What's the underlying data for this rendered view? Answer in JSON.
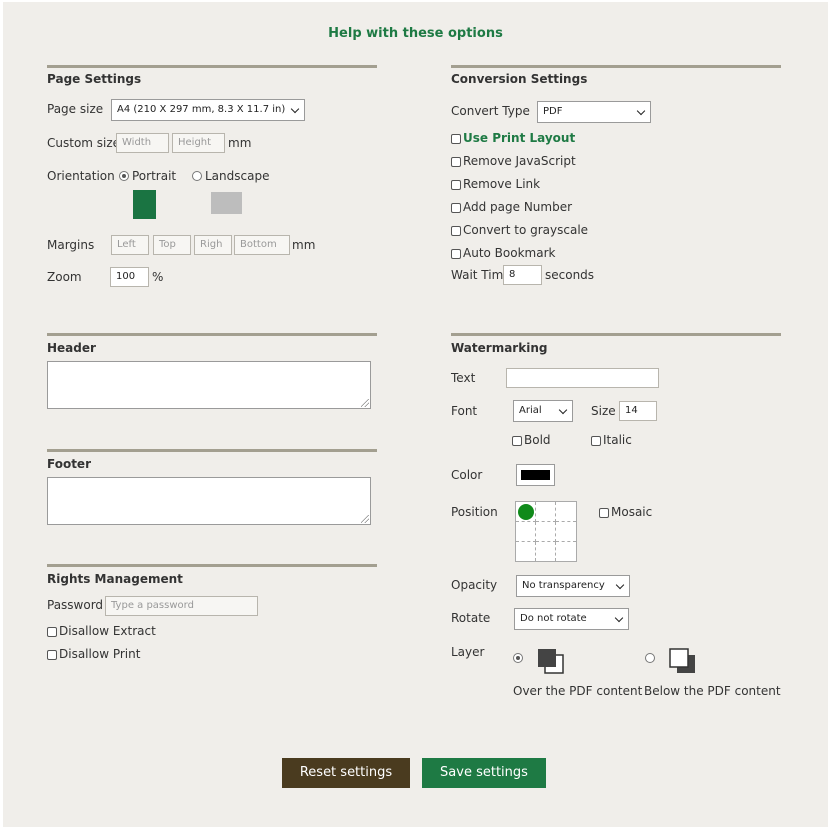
{
  "help_link": "Help with these options",
  "page_settings": {
    "title": "Page Settings",
    "page_size_label": "Page size",
    "page_size_value": "A4 (210 X 297 mm, 8.3 X 11.7 in)",
    "custom_size_label": "Custom size",
    "width_placeholder": "Width",
    "height_placeholder": "Height",
    "custom_unit": "mm",
    "orientation_label": "Orientation",
    "portrait_label": "Portrait",
    "landscape_label": "Landscape",
    "margins_label": "Margins",
    "margin_left_placeholder": "Left",
    "margin_top_placeholder": "Top",
    "margin_right_placeholder": "Righ",
    "margin_bottom_placeholder": "Bottom",
    "margins_unit": "mm",
    "zoom_label": "Zoom",
    "zoom_value": "100",
    "zoom_unit": "%"
  },
  "conversion_settings": {
    "title": "Conversion Settings",
    "convert_type_label": "Convert Type",
    "convert_type_value": "PDF",
    "options": [
      "Use Print Layout",
      "Remove JavaScript",
      "Remove Link",
      "Add page Number",
      "Convert to grayscale",
      "Auto Bookmark"
    ],
    "wait_time_label": "Wait Time",
    "wait_time_value": "8",
    "wait_time_unit": "seconds"
  },
  "header": {
    "title": "Header"
  },
  "footer": {
    "title": "Footer"
  },
  "rights": {
    "title": "Rights Management",
    "password_label": "Password",
    "password_placeholder": "Type a password",
    "disallow_extract": "Disallow Extract",
    "disallow_print": "Disallow Print"
  },
  "watermarking": {
    "title": "Watermarking",
    "text_label": "Text",
    "font_label": "Font",
    "font_value": "Arial",
    "size_label": "Size",
    "size_value": "14",
    "bold_label": "Bold",
    "italic_label": "Italic",
    "color_label": "Color",
    "color_value": "#000000",
    "position_label": "Position",
    "mosaic_label": "Mosaic",
    "opacity_label": "Opacity",
    "opacity_value": "No transparency",
    "rotate_label": "Rotate",
    "rotate_value": "Do not rotate",
    "layer_label": "Layer",
    "layer_over_label": "Over the PDF content",
    "layer_below_label": "Below the PDF content"
  },
  "buttons": {
    "reset": "Reset settings",
    "save": "Save settings"
  },
  "colors": {
    "accent_green": "#1e7a44",
    "reset_brown": "#4a3b1f",
    "position_marker": "#0f8a1a",
    "section_line": "#a39f90"
  }
}
